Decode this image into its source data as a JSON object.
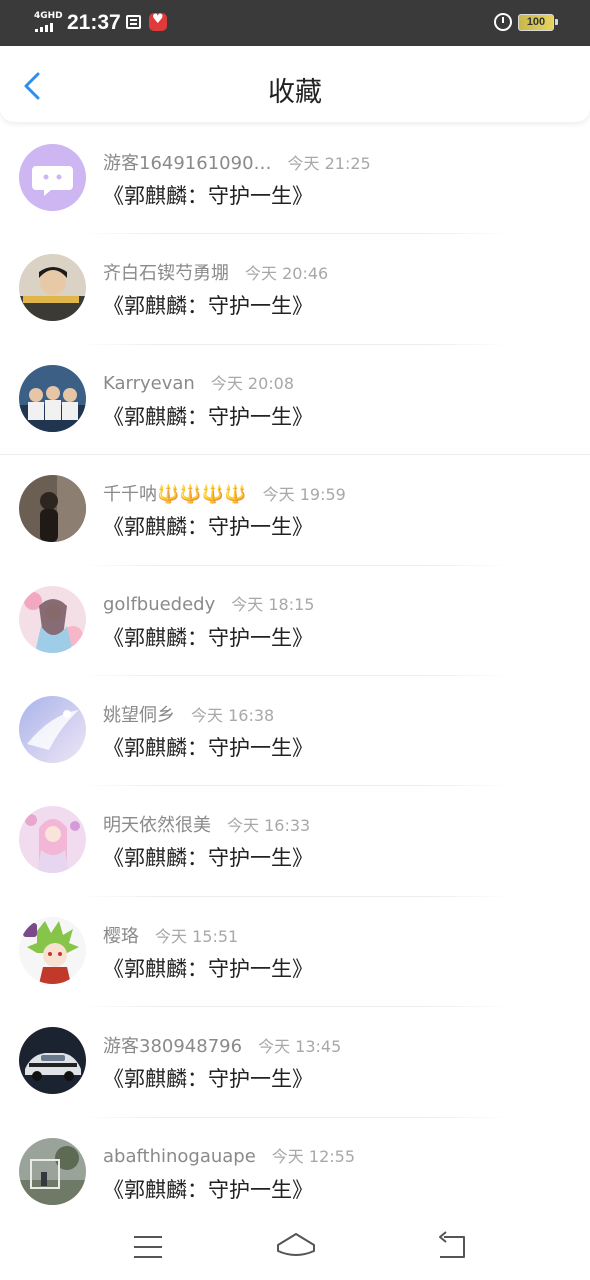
{
  "status_bar": {
    "network": "4GHD",
    "time": "21:37",
    "battery": "100"
  },
  "header": {
    "title": "收藏"
  },
  "favorites": [
    {
      "user": "游客1649161090…",
      "time": "今天 21:25",
      "content": "《郭麒麟：守护一生》"
    },
    {
      "user": "齐白石锲芍勇堋",
      "time": "今天 20:46",
      "content": "《郭麒麟：守护一生》"
    },
    {
      "user": "Karryevan",
      "time": "今天 20:08",
      "content": "《郭麒麟：守护一生》"
    },
    {
      "user": "千千呐🔱🔱🔱🔱",
      "time": "今天 19:59",
      "content": "《郭麒麟：守护一生》"
    },
    {
      "user": "golfbuededy",
      "time": "今天 18:15",
      "content": "《郭麒麟：守护一生》"
    },
    {
      "user": "姚望侗乡",
      "time": "今天 16:38",
      "content": "《郭麒麟：守护一生》"
    },
    {
      "user": "明天依然很美",
      "time": "今天 16:33",
      "content": "《郭麒麟：守护一生》"
    },
    {
      "user": "樱珞",
      "time": "今天 15:51",
      "content": "《郭麒麟：守护一生》"
    },
    {
      "user": "游客380948796",
      "time": "今天 13:45",
      "content": "《郭麒麟：守护一生》"
    },
    {
      "user": "abafthinogauape",
      "time": "今天 12:55",
      "content": "《郭麒麟：守护一生》"
    }
  ],
  "colors": {
    "accent": "#2a8ff0",
    "status_bar": "#3a3a3a",
    "username": "#8a8a8a",
    "timestamp": "#a8a8a8"
  },
  "icons": {
    "back": "chevron-left-icon",
    "menu": "menu-icon",
    "home": "home-icon",
    "return": "back-arrow-icon"
  }
}
